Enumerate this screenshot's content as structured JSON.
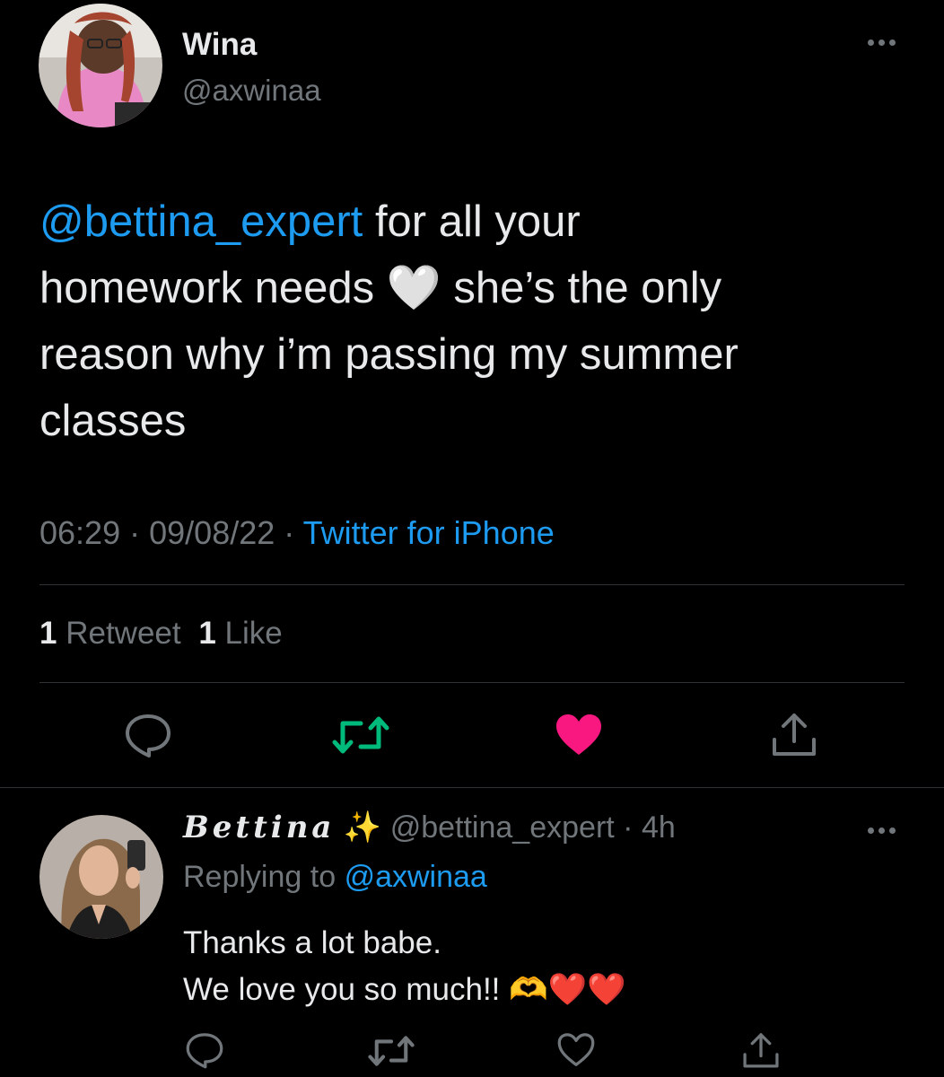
{
  "tweet": {
    "author_name": "Wina",
    "author_handle": "@axwinaa",
    "text": {
      "mention": "@bettina_expert",
      "part1": "for all your",
      "part2": "homework needs",
      "heart_emoji": "🤍",
      "part3": "she’s the only",
      "line3": "reason why i’m passing my summer",
      "line4": "classes"
    },
    "time": "06:29",
    "sep1": "·",
    "date": "09/08/22",
    "sep2": "·",
    "source": "Twitter for iPhone",
    "retweet_count": "1",
    "retweet_label": "Retweet",
    "like_count": "1",
    "like_label": "Like",
    "liked": true,
    "colors": {
      "like_active": "#f91880",
      "retweet_icon": "#00ba7c",
      "link": "#1d9bf0"
    }
  },
  "reply": {
    "author_name": "Bettina",
    "author_badge": "✨",
    "author_handle": "@bettina_expert",
    "sep": "·",
    "time_ago": "4h",
    "replying_label": "Replying to",
    "replying_handle": "@axwinaa",
    "line1": "Thanks a lot babe.",
    "line2": "We love you so much!!",
    "emojis": "🫶❤️❤️"
  },
  "icons": [
    "reply-icon",
    "retweet-icon",
    "like-icon",
    "share-icon",
    "more-icon"
  ]
}
